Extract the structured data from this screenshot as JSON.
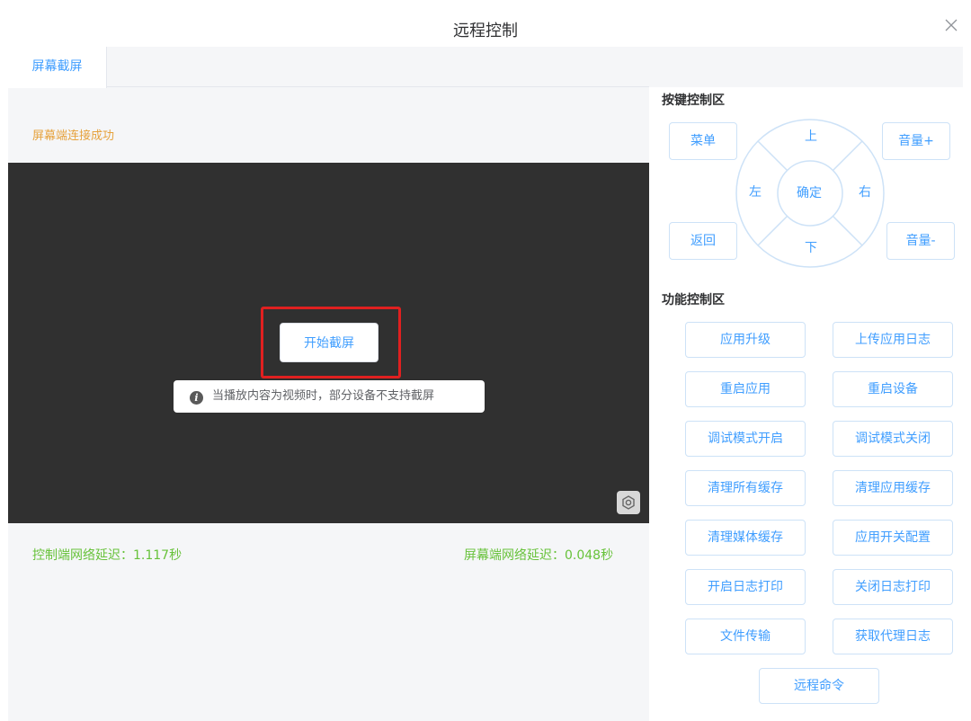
{
  "dialog": {
    "title": "远程控制"
  },
  "tabs": [
    {
      "label": "屏幕截屏"
    }
  ],
  "left": {
    "connection_status": "屏幕端连接成功",
    "start_button": "开始截屏",
    "tip": "当播放内容为视频时，部分设备不支持截屏",
    "control_latency": "控制端网络延迟：1.117秒",
    "screen_latency": "屏幕端网络延迟：0.048秒"
  },
  "key_control": {
    "title": "按键控制区",
    "menu": "菜单",
    "back": "返回",
    "vol_up": "音量+",
    "vol_down": "音量-",
    "up": "上",
    "down": "下",
    "left": "左",
    "right": "右",
    "ok": "确定"
  },
  "function_control": {
    "title": "功能控制区",
    "buttons": [
      "应用升级",
      "上传应用日志",
      "重启应用",
      "重启设备",
      "调试模式开启",
      "调试模式关闭",
      "清理所有缓存",
      "清理应用缓存",
      "清理媒体缓存",
      "应用开关配置",
      "开启日志打印",
      "关闭日志打印",
      "文件传输",
      "获取代理日志",
      "远程命令"
    ]
  },
  "colors": {
    "accent": "#409eff",
    "warning": "#e6a23c",
    "success": "#67c23a",
    "highlight": "#e02020",
    "screen_bg": "#303030"
  }
}
